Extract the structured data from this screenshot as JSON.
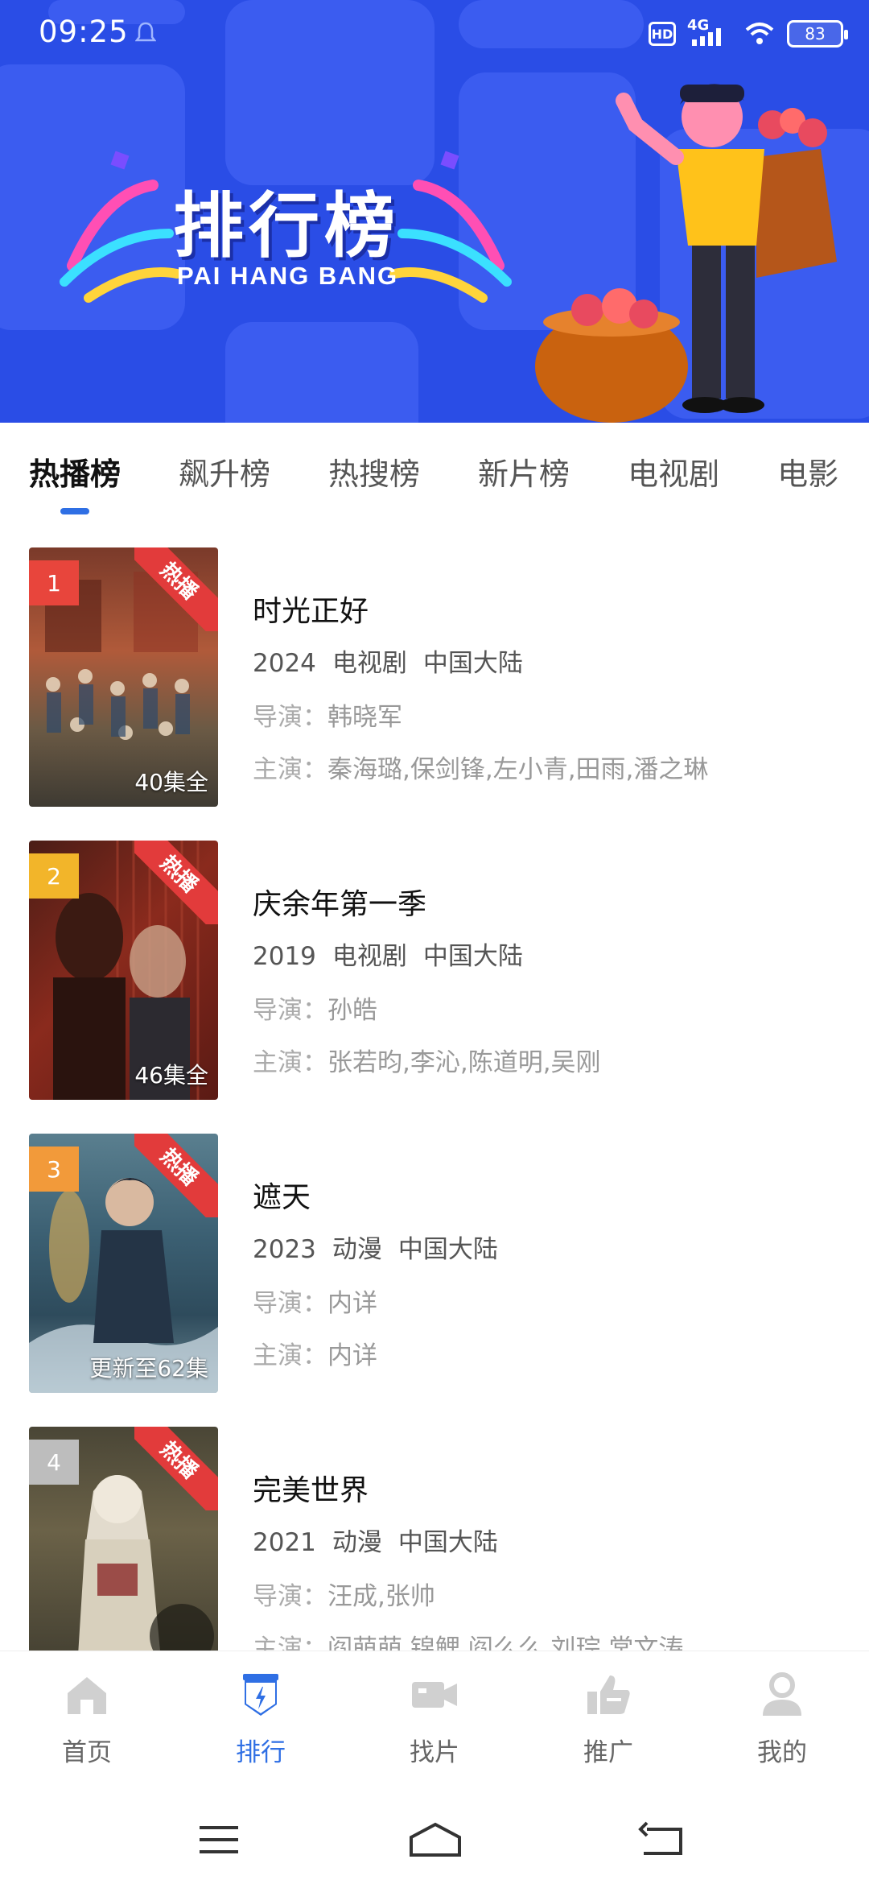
{
  "status": {
    "time": "09:25",
    "hd": "HD",
    "network": "4G",
    "battery": "83"
  },
  "banner": {
    "title": "排行榜",
    "subtitle": "PAI HANG BANG"
  },
  "tabs": [
    {
      "label": "热播榜",
      "active": true
    },
    {
      "label": "飙升榜",
      "active": false
    },
    {
      "label": "热搜榜",
      "active": false
    },
    {
      "label": "新片榜",
      "active": false
    },
    {
      "label": "电视剧",
      "active": false
    },
    {
      "label": "电影",
      "active": false
    }
  ],
  "labels": {
    "director": "导演：",
    "cast": "主演："
  },
  "items": [
    {
      "rank": "1",
      "hot": "热播",
      "episodes": "40集全",
      "title": "时光正好",
      "year": "2024",
      "category": "电视剧",
      "region": "中国大陆",
      "director": "韩晓军",
      "cast": "秦海璐,保剑锋,左小青,田雨,潘之琳",
      "rank_color": "#e8453c"
    },
    {
      "rank": "2",
      "hot": "热播",
      "episodes": "46集全",
      "title": "庆余年第一季",
      "year": "2019",
      "category": "电视剧",
      "region": "中国大陆",
      "director": "孙皓",
      "cast": "张若昀,李沁,陈道明,吴刚",
      "rank_color": "#f2b52a"
    },
    {
      "rank": "3",
      "hot": "热播",
      "episodes": "更新至62集",
      "title": "遮天",
      "year": "2023",
      "category": "动漫",
      "region": "中国大陆",
      "director": "内详",
      "cast": "内详",
      "rank_color": "#f29a3a"
    },
    {
      "rank": "4",
      "hot": "热播",
      "episodes": "",
      "title": "完美世界",
      "year": "2021",
      "category": "动漫",
      "region": "中国大陆",
      "director": "汪成,张帅",
      "cast": "阎萌萌,锦鲤,阎么么,刘琮,常文涛",
      "rank_color": "#bdbdbd"
    }
  ],
  "nav": [
    {
      "label": "首页",
      "icon": "home-icon"
    },
    {
      "label": "排行",
      "icon": "ranking-icon",
      "active": true
    },
    {
      "label": "找片",
      "icon": "video-camera-icon"
    },
    {
      "label": "推广",
      "icon": "thumbs-up-icon"
    },
    {
      "label": "我的",
      "icon": "user-icon"
    }
  ],
  "colors": {
    "accent": "#2f6fe4",
    "banner": "#2a4de6",
    "hot": "#e23b3b"
  }
}
